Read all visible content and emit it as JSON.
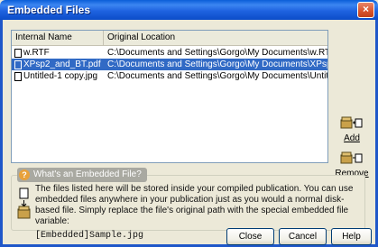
{
  "window": {
    "title": "Embedded Files",
    "close_glyph": "×"
  },
  "list": {
    "columns": [
      "Internal Name",
      "Original Location"
    ],
    "rows": [
      {
        "name": "w.RTF",
        "location": "C:\\Documents and Settings\\Gorgo\\My Documents\\w.RT",
        "selected": false,
        "icon": "file-icon"
      },
      {
        "name": "XPsp2_and_BT.pdf",
        "location": "C:\\Documents and Settings\\Gorgo\\My Documents\\XPsp",
        "selected": true,
        "icon": "file-icon"
      },
      {
        "name": "Untitled-1 copy.jpg",
        "location": "C:\\Documents and Settings\\Gorgo\\My Documents\\Untitl",
        "selected": false,
        "icon": "file-icon"
      }
    ]
  },
  "side_buttons": {
    "add": "Add",
    "remove": "Remove"
  },
  "help_box": {
    "title": "What's an Embedded File?",
    "body": "The files listed here will be stored inside your compiled publication. You can use embedded files anywhere in your publication just as you would a normal disk-based file. Simply replace the file's original path with the special embedded file variable:",
    "code": "[Embedded]Sample.jpg"
  },
  "buttons": {
    "close": "Close",
    "cancel": "Cancel",
    "help": "Help"
  },
  "colors": {
    "title_bar": "#1f63e0",
    "selection": "#316ac5",
    "close_button": "#d8532c",
    "dialog_bg": "#ece9d8"
  }
}
